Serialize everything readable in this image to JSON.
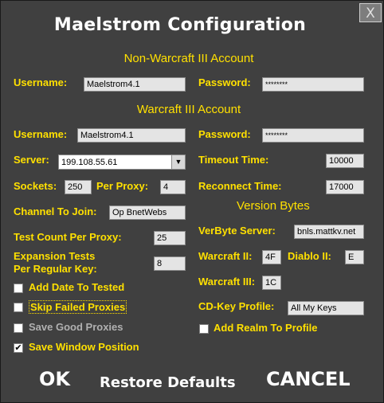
{
  "title": "Maelstrom Configuration",
  "close_label": "X",
  "non_wc3": {
    "heading": "Non-Warcraft III Account",
    "username_label": "Username:",
    "username_value": "Maelstrom4.1",
    "password_label": "Password:",
    "password_value": "********"
  },
  "wc3": {
    "heading": "Warcraft III Account",
    "username_label": "Username:",
    "username_value": "Maelstrom4.1",
    "password_label": "Password:",
    "password_value": "********"
  },
  "server": {
    "label": "Server:",
    "value": "199.108.55.61"
  },
  "timeout": {
    "label": "Timeout Time:",
    "value": "10000"
  },
  "sockets": {
    "label": "Sockets:",
    "value": "250"
  },
  "per_proxy": {
    "label": "Per Proxy:",
    "value": "4"
  },
  "reconnect": {
    "label": "Reconnect Time:",
    "value": "17000"
  },
  "channel": {
    "label": "Channel To Join:",
    "value": "Op BnetWebs"
  },
  "version_bytes_heading": "Version Bytes",
  "test_count": {
    "label": "Test Count Per Proxy:",
    "value": "25"
  },
  "verbyte_server": {
    "label": "VerByte Server:",
    "value": "bnls.mattkv.net"
  },
  "expansion_tests": {
    "label_line1": "Expansion Tests",
    "label_line2": "Per Regular Key:",
    "value": "8"
  },
  "warcraft2": {
    "label": "Warcraft II:",
    "value": "4F"
  },
  "diablo2": {
    "label": "Diablo II:",
    "value": "E"
  },
  "warcraft3": {
    "label": "Warcraft III:",
    "value": "1C"
  },
  "cdkey_profile": {
    "label": "CD-Key Profile:",
    "value": "All My Keys"
  },
  "checkboxes": {
    "add_date": {
      "label": "Add Date To Tested",
      "checked": false
    },
    "skip_failed": {
      "label": "Skip Failed Proxies",
      "checked": false
    },
    "save_good": {
      "label": "Save Good Proxies",
      "checked": false
    },
    "save_window": {
      "label": "Save Window Position",
      "checked": true,
      "mark": "✔"
    },
    "add_realm": {
      "label": "Add Realm To Profile",
      "checked": false
    }
  },
  "buttons": {
    "ok": "OK",
    "restore": "Restore Defaults",
    "cancel": "CANCEL"
  },
  "colors": {
    "background": "#404040",
    "label": "#ffe000",
    "title": "#ffffff",
    "disabled_label": "#b0b0b0"
  },
  "icons": {
    "dropdown": "chevron-down-icon"
  }
}
